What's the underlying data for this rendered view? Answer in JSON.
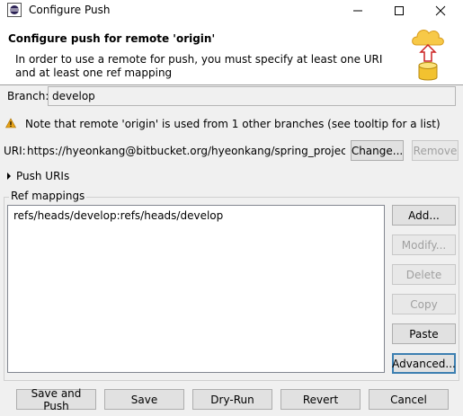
{
  "window": {
    "title": "Configure Push",
    "minimize_glyph": "─",
    "maximize_glyph": "☐",
    "close_glyph": "✕"
  },
  "header": {
    "title": "Configure push for remote 'origin'",
    "message": "In order to use a remote for push, you must specify at least one URI and at least one ref mapping"
  },
  "branch": {
    "label": "Branch:",
    "value": "develop"
  },
  "warning": {
    "text": "Note that remote 'origin' is used from 1 other branches (see tooltip for a list)"
  },
  "uri": {
    "label": "URI:",
    "value": "https://hyeonkang@bitbucket.org/hyeonkang/spring_project_repo",
    "change_label": "Change...",
    "remove_label": "Remove"
  },
  "push_uris": {
    "label": "Push URIs"
  },
  "ref_mappings": {
    "label": "Ref mappings",
    "items": [
      "refs/heads/develop:refs/heads/develop"
    ],
    "buttons": {
      "add": "Add...",
      "modify": "Modify...",
      "delete": "Delete",
      "copy": "Copy",
      "paste": "Paste",
      "advanced": "Advanced..."
    }
  },
  "footer": {
    "save_and_push": "Save and Push",
    "save": "Save",
    "dry_run": "Dry-Run",
    "revert": "Revert",
    "cancel": "Cancel"
  },
  "colors": {
    "accent": "#3c7fb1",
    "warning": "#e8a317",
    "cloud": "#f7c948"
  }
}
